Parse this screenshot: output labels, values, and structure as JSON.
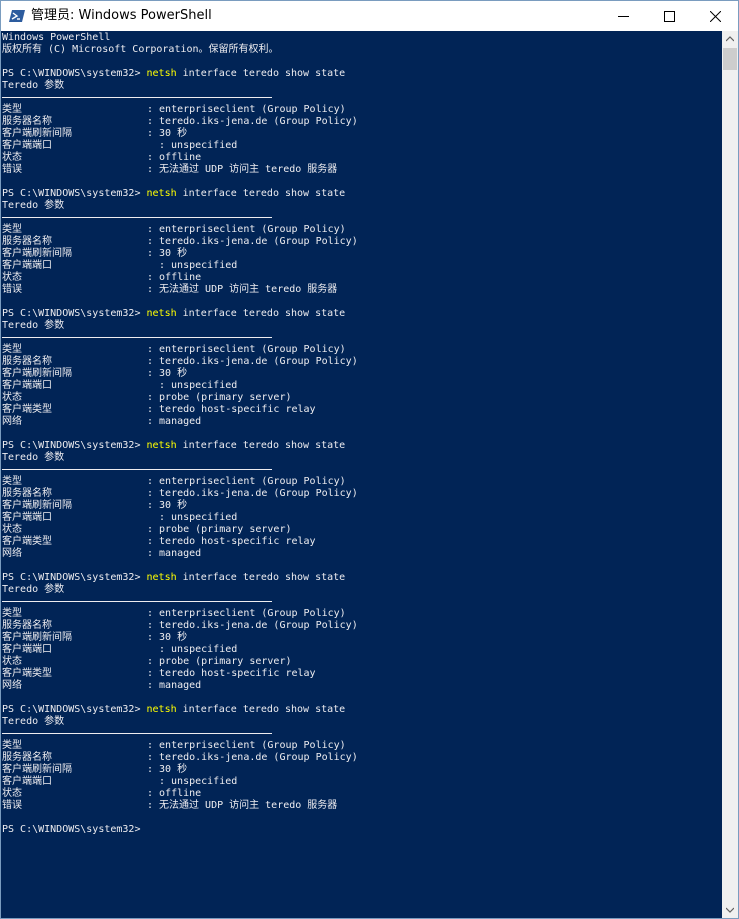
{
  "window": {
    "title": "管理员: Windows PowerShell",
    "icon": "powershell-icon",
    "controls": {
      "minimize": "minimize-icon",
      "maximize": "maximize-icon",
      "close": "close-icon"
    }
  },
  "colors": {
    "console_bg": "#012456",
    "text": "#eeedf0",
    "command": "#ffff00",
    "titlebar_bg": "#ffffff"
  },
  "console": {
    "header": [
      "Windows PowerShell",
      "版权所有 (C) Microsoft Corporation。保留所有权利。"
    ],
    "prompt": "PS C:\\WINDOWS\\system32>",
    "command_keyword": "netsh",
    "command_args": " interface teredo show state",
    "section_title": "Teredo 参数",
    "blocks": [
      {
        "rows": [
          {
            "label": "类型",
            "value": ": enterpriseclient (Group Policy)"
          },
          {
            "label": "服务器名称",
            "value": ": teredo.iks-jena.de (Group Policy)"
          },
          {
            "label": "客户端刷新间隔",
            "value": ": 30 秒"
          },
          {
            "label": "客户端端口",
            "value": ": unspecified"
          },
          {
            "label": "状态",
            "value": ": offline"
          },
          {
            "label": "错误",
            "value": ": 无法通过 UDP 访问主 teredo 服务器"
          }
        ]
      },
      {
        "rows": [
          {
            "label": "类型",
            "value": ": enterpriseclient (Group Policy)"
          },
          {
            "label": "服务器名称",
            "value": ": teredo.iks-jena.de (Group Policy)"
          },
          {
            "label": "客户端刷新间隔",
            "value": ": 30 秒"
          },
          {
            "label": "客户端端口",
            "value": ": unspecified"
          },
          {
            "label": "状态",
            "value": ": offline"
          },
          {
            "label": "错误",
            "value": ": 无法通过 UDP 访问主 teredo 服务器"
          }
        ]
      },
      {
        "rows": [
          {
            "label": "类型",
            "value": ": enterpriseclient (Group Policy)"
          },
          {
            "label": "服务器名称",
            "value": ": teredo.iks-jena.de (Group Policy)"
          },
          {
            "label": "客户端刷新间隔",
            "value": ": 30 秒"
          },
          {
            "label": "客户端端口",
            "value": ": unspecified"
          },
          {
            "label": "状态",
            "value": ": probe (primary server)"
          },
          {
            "label": "客户端类型",
            "value": ": teredo host-specific relay"
          },
          {
            "label": "网络",
            "value": ": managed"
          }
        ]
      },
      {
        "rows": [
          {
            "label": "类型",
            "value": ": enterpriseclient (Group Policy)"
          },
          {
            "label": "服务器名称",
            "value": ": teredo.iks-jena.de (Group Policy)"
          },
          {
            "label": "客户端刷新间隔",
            "value": ": 30 秒"
          },
          {
            "label": "客户端端口",
            "value": ": unspecified"
          },
          {
            "label": "状态",
            "value": ": probe (primary server)"
          },
          {
            "label": "客户端类型",
            "value": ": teredo host-specific relay"
          },
          {
            "label": "网络",
            "value": ": managed"
          }
        ]
      },
      {
        "rows": [
          {
            "label": "类型",
            "value": ": enterpriseclient (Group Policy)"
          },
          {
            "label": "服务器名称",
            "value": ": teredo.iks-jena.de (Group Policy)"
          },
          {
            "label": "客户端刷新间隔",
            "value": ": 30 秒"
          },
          {
            "label": "客户端端口",
            "value": ": unspecified"
          },
          {
            "label": "状态",
            "value": ": probe (primary server)"
          },
          {
            "label": "客户端类型",
            "value": ": teredo host-specific relay"
          },
          {
            "label": "网络",
            "value": ": managed"
          }
        ]
      },
      {
        "rows": [
          {
            "label": "类型",
            "value": ": enterpriseclient (Group Policy)"
          },
          {
            "label": "服务器名称",
            "value": ": teredo.iks-jena.de (Group Policy)"
          },
          {
            "label": "客户端刷新间隔",
            "value": ": 30 秒"
          },
          {
            "label": "客户端端口",
            "value": ": unspecified"
          },
          {
            "label": "状态",
            "value": ": offline"
          },
          {
            "label": "错误",
            "value": ": 无法通过 UDP 访问主 teredo 服务器"
          }
        ]
      }
    ]
  }
}
